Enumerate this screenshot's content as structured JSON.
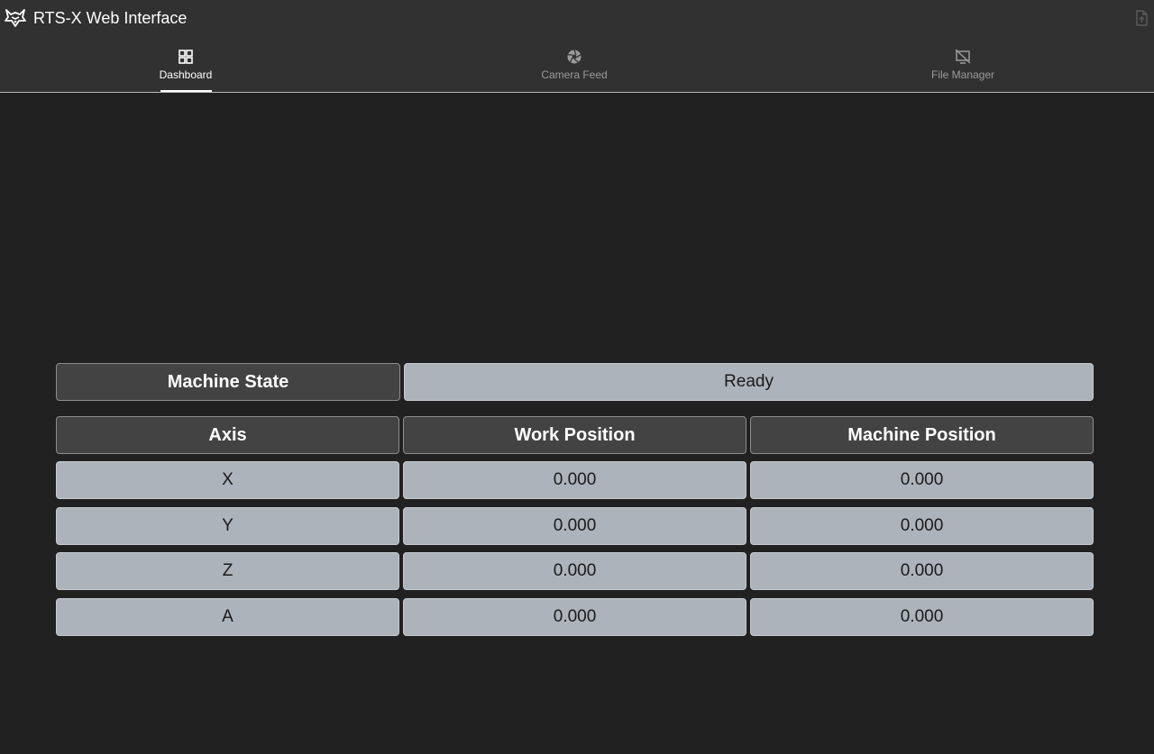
{
  "header": {
    "title": "RTS-X Web Interface",
    "logo_icon": "fox-logo-icon",
    "upload_icon": "file-upload-icon"
  },
  "tabs": [
    {
      "label": "Dashboard",
      "icon": "dashboard-icon",
      "active": true
    },
    {
      "label": "Camera Feed",
      "icon": "camera-aperture-icon",
      "active": false
    },
    {
      "label": "File Manager",
      "icon": "display-off-icon",
      "active": false
    }
  ],
  "machine_state": {
    "label": "Machine State",
    "value": "Ready"
  },
  "positions": {
    "columns": [
      "Axis",
      "Work Position",
      "Machine Position"
    ],
    "rows": [
      {
        "axis": "X",
        "work": "0.000",
        "machine": "0.000"
      },
      {
        "axis": "Y",
        "work": "0.000",
        "machine": "0.000"
      },
      {
        "axis": "Z",
        "work": "0.000",
        "machine": "0.000"
      },
      {
        "axis": "A",
        "work": "0.000",
        "machine": "0.000"
      }
    ]
  },
  "colors": {
    "background": "#212121",
    "topbar": "#313131",
    "header_cell": "#434343",
    "value_cell": "#acb3bb"
  }
}
